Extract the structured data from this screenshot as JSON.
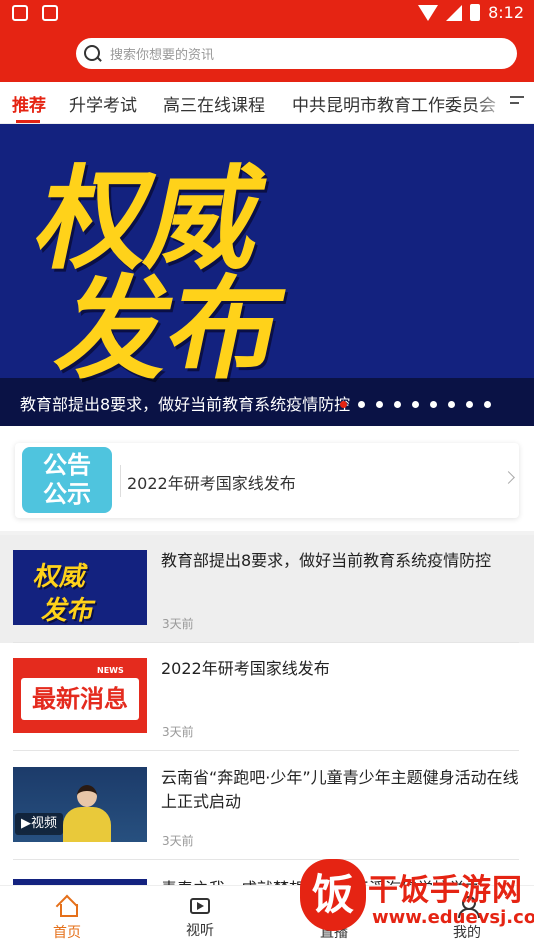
{
  "status_bar": {
    "time": "8:12"
  },
  "search": {
    "placeholder": "搜索你想要的资讯"
  },
  "tabs": [
    {
      "label": "推荐",
      "active": true
    },
    {
      "label": "升学考试"
    },
    {
      "label": "高三在线课程"
    },
    {
      "label": "中共昆明市教育工作委员会"
    }
  ],
  "banner": {
    "image_text_line1": "权威",
    "image_text_line2": "发布",
    "caption": "教育部提出8要求，做好当前教育系统疫情防控",
    "slide_count": 9,
    "active_slide": 1
  },
  "notice": {
    "logo_line1": "公告",
    "logo_line2": "公示",
    "text": "2022年研考国家线发布"
  },
  "news": [
    {
      "title": "教育部提出8要求，做好当前教育系统疫情防控",
      "time": "3天前",
      "thumb_line1": "权威",
      "thumb_line2": "发布"
    },
    {
      "title": "2022年研考国家线发布",
      "time": "3天前",
      "thumb_label": "NEWS",
      "thumb_text": "最新消息"
    },
    {
      "title": "云南省“奔跑吧·少年”儿童青少年主题健身活动在线上正式启动",
      "time": "3天前",
      "video_tag": "▶视频"
    },
    {
      "title": "青春之我，成就梦想，云南玉溪汽修学校举办"
    }
  ],
  "bottom_nav": [
    {
      "label": "首页",
      "icon": "home-icon",
      "active": true
    },
    {
      "label": "视听",
      "icon": "video-icon"
    },
    {
      "label": "直播",
      "icon": "live-icon"
    },
    {
      "label": "我的",
      "icon": "user-icon"
    }
  ],
  "watermark": {
    "logo": "饭",
    "title": "干饭手游网",
    "url": "www.eduevsj.com"
  },
  "colors": {
    "brand_red": "#e52413",
    "nav_active": "#e5701a",
    "banner_blue": "#13227f",
    "banner_yellow": "#ffd21a"
  }
}
